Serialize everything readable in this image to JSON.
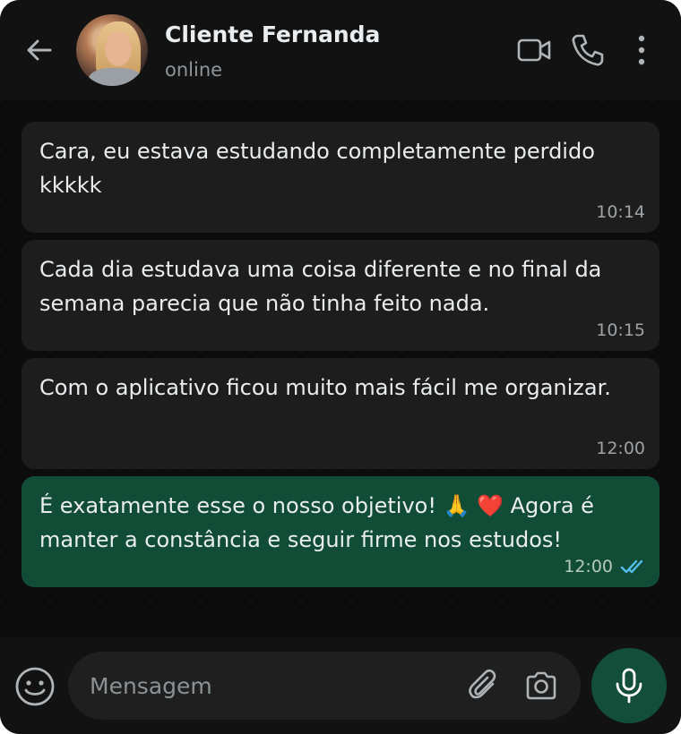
{
  "header": {
    "contact_name": "Cliente Fernanda",
    "status": "online",
    "icons": [
      "back-arrow-icon",
      "video-call-icon",
      "phone-icon",
      "more-options-icon"
    ]
  },
  "messages": [
    {
      "direction": "incoming",
      "text": "Cara, eu estava estudando completamente perdido kkkkk",
      "time": "10:14"
    },
    {
      "direction": "incoming",
      "text": "Cada dia estudava uma coisa diferente e no final da semana parecia que não tinha feito nada.",
      "time": "10:15"
    },
    {
      "direction": "incoming",
      "text": "Com o aplicativo ficou muito mais fácil me organizar.",
      "time": "12:00"
    },
    {
      "direction": "outgoing",
      "text": "É exatamente esse o nosso objetivo! 🙏 ❤️ Agora é manter a constância e seguir firme nos estudos!",
      "time": "12:00",
      "read": true
    }
  ],
  "composer": {
    "placeholder": "Mensagem",
    "icons": [
      "emoji-icon",
      "paperclip-icon",
      "camera-icon",
      "microphone-icon"
    ]
  },
  "colors": {
    "background": "#0b0b0b",
    "incoming_bubble": "#1d1d1d",
    "outgoing_bubble": "#114c36",
    "read_ticks": "#53bdeb",
    "mic_button": "#134e3a"
  }
}
